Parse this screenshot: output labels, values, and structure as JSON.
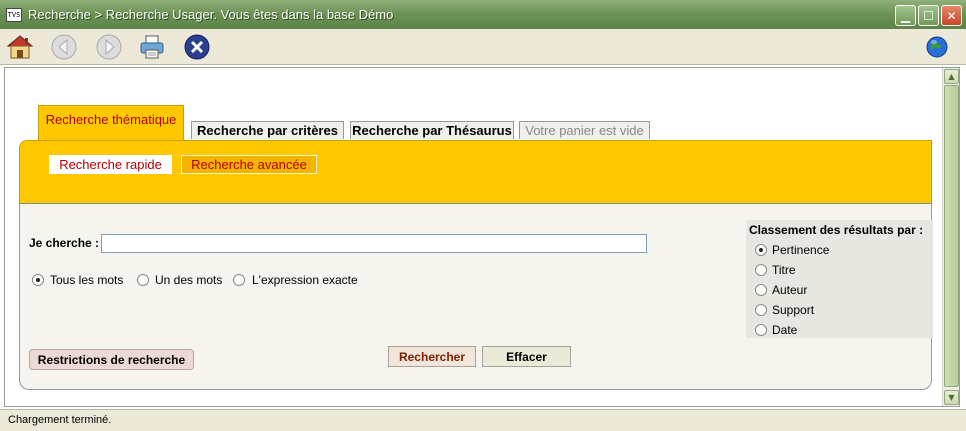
{
  "window": {
    "icon_text": "TVS",
    "title": "Recherche > Recherche Usager.  Vous êtes dans la base Démo"
  },
  "tabs": [
    {
      "label": "Recherche thématique",
      "state": "active"
    },
    {
      "label": "Recherche par critères",
      "state": "normal"
    },
    {
      "label": "Recherche par Thésaurus",
      "state": "normal"
    },
    {
      "label": "Votre panier est vide",
      "state": "disabled"
    }
  ],
  "subtabs": [
    {
      "label": "Recherche rapide"
    },
    {
      "label": "Recherche avancée"
    }
  ],
  "search": {
    "label": "Je cherche :",
    "value": ""
  },
  "match_options": [
    {
      "label": "Tous les mots",
      "selected": true
    },
    {
      "label": "Un des mots",
      "selected": false
    },
    {
      "label": "L'expression exacte",
      "selected": false
    }
  ],
  "sort": {
    "title": "Classement des résultats par :",
    "options": [
      {
        "label": "Pertinence",
        "selected": true
      },
      {
        "label": "Titre",
        "selected": false
      },
      {
        "label": "Auteur",
        "selected": false
      },
      {
        "label": "Support",
        "selected": false
      },
      {
        "label": "Date",
        "selected": false
      }
    ]
  },
  "buttons": {
    "restrictions": "Restrictions de recherche",
    "search": "Rechercher",
    "clear": "Effacer"
  },
  "status": "Chargement terminé.",
  "colors": {
    "tab_yellow": "#fdc800",
    "accent_red": "#b40000"
  }
}
